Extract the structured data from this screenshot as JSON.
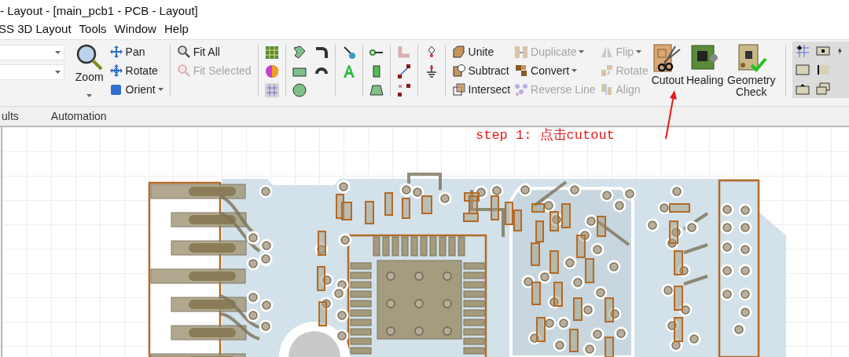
{
  "window": {
    "title": "- Layout - [main_pcb1 - PCB - Layout]"
  },
  "menu": [
    {
      "label": "SS 3D Layout"
    },
    {
      "label": "Tools"
    },
    {
      "label": "Window"
    },
    {
      "label": "Help"
    }
  ],
  "ribbon": {
    "zoom": {
      "label": "Zoom",
      "has_menu": true
    },
    "view": [
      {
        "label": "Pan",
        "disabled": false,
        "has_menu": false
      },
      {
        "label": "Rotate",
        "disabled": false,
        "has_menu": false
      },
      {
        "label": "Orient",
        "disabled": false,
        "has_menu": true
      }
    ],
    "fit": [
      {
        "label": "Fit All",
        "disabled": false,
        "has_menu": false
      },
      {
        "label": "Fit Selected",
        "disabled": true,
        "has_menu": false
      }
    ],
    "boolean": [
      {
        "label": "Unite",
        "disabled": false,
        "has_menu": false
      },
      {
        "label": "Subtract",
        "disabled": false,
        "has_menu": false
      },
      {
        "label": "Intersect",
        "disabled": false,
        "has_menu": false
      }
    ],
    "edit": [
      {
        "label": "Duplicate",
        "disabled": true,
        "has_menu": true
      },
      {
        "label": "Convert",
        "disabled": false,
        "has_menu": true
      },
      {
        "label": "Reverse Line",
        "disabled": true,
        "has_menu": false
      }
    ],
    "transform": [
      {
        "label": "Flip",
        "disabled": true,
        "has_menu": true
      },
      {
        "label": "Rotate",
        "disabled": true,
        "has_menu": false
      },
      {
        "label": "Align",
        "disabled": true,
        "has_menu": false
      }
    ],
    "large": [
      {
        "label": "Cutout"
      },
      {
        "label": "Healing"
      },
      {
        "label": "Geometry Check"
      }
    ]
  },
  "tabs": [
    {
      "label": "ults",
      "selected": false
    },
    {
      "label": "Automation",
      "selected": false
    }
  ],
  "annotation": {
    "text": "step 1: 点击cutout"
  }
}
